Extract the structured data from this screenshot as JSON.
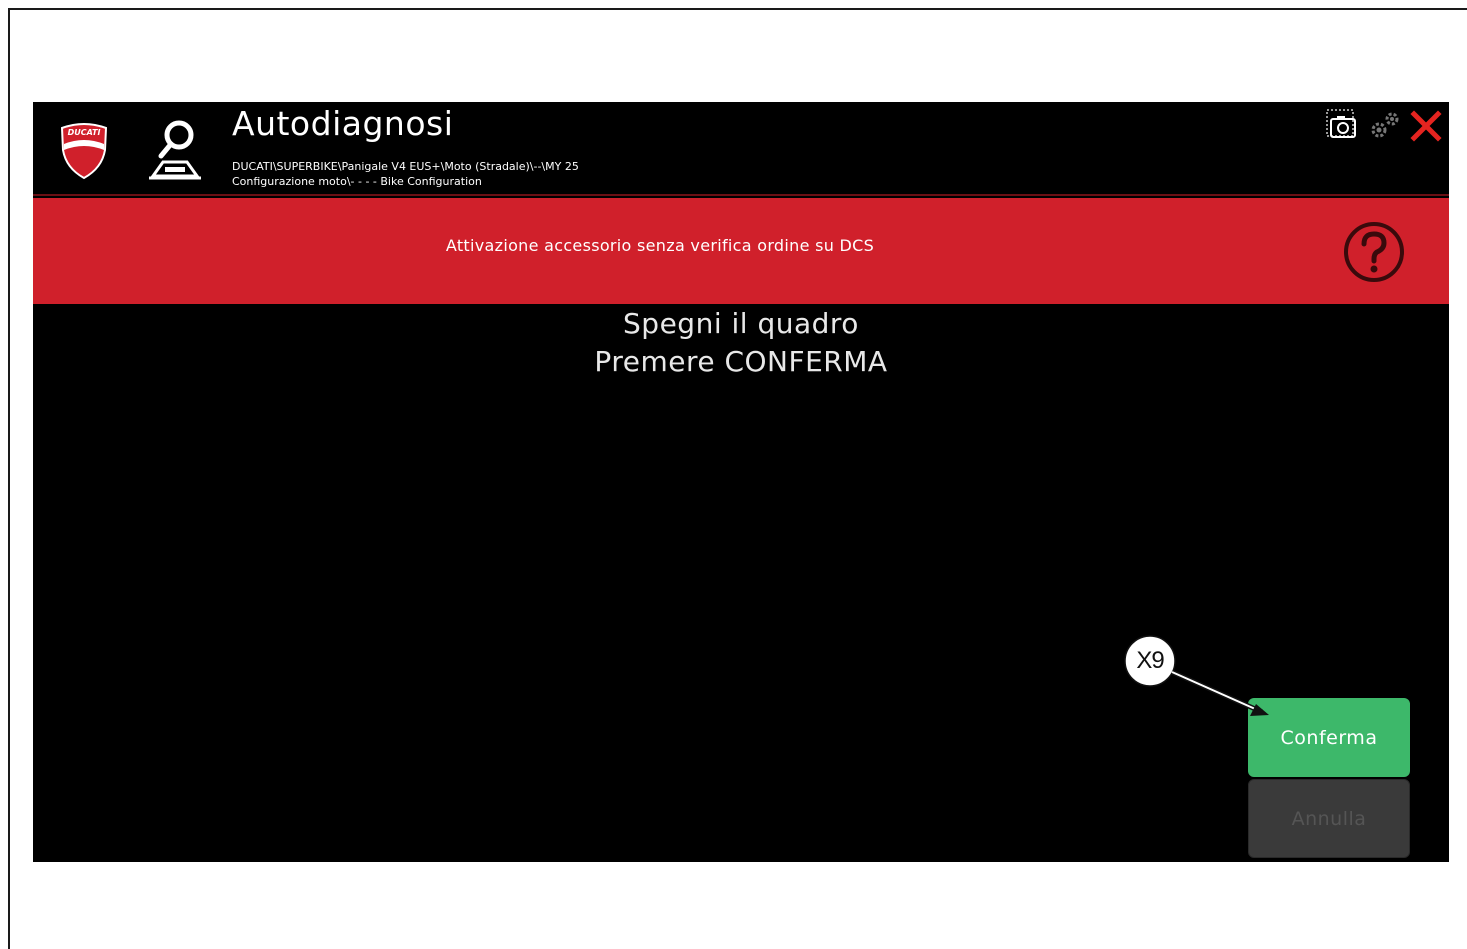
{
  "window": {
    "title": "Autodiagnosi",
    "path_line_1": "DUCATI\\SUPERBIKE\\Panigale V4 EUS+\\Moto (Stradale)\\--\\MY 25",
    "path_line_2": "Configurazione moto\\- - - - Bike Configuration",
    "logo_text": "DUCATI"
  },
  "toolbar": {
    "icons": [
      "screenshot-icon",
      "settings-icon",
      "close-icon"
    ],
    "close_color": "#e52420"
  },
  "banner": {
    "text": "Attivazione accessorio senza verifica ordine su DCS",
    "color": "#d0202b",
    "help_icon": "help-icon"
  },
  "main": {
    "line_1": "Spegni il quadro",
    "line_2": "Premere CONFERMA"
  },
  "buttons": {
    "confirm_label": "Conferma",
    "confirm_color": "#3db86a",
    "cancel_label": "Annulla"
  },
  "callout": {
    "label": "X9"
  }
}
